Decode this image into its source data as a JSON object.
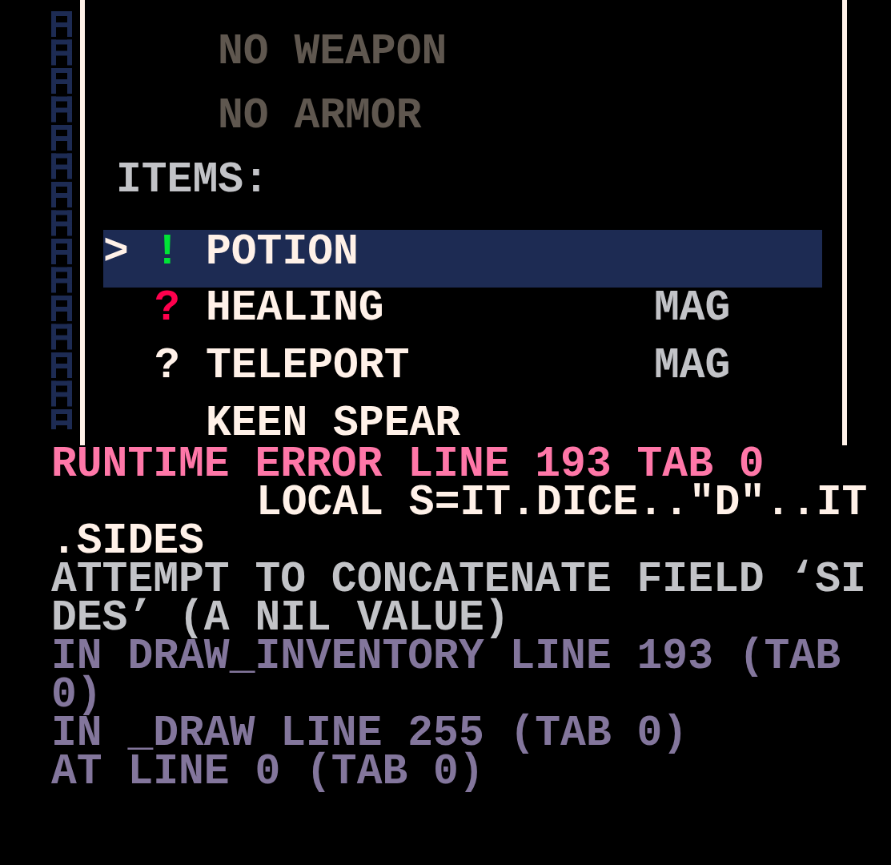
{
  "inventory": {
    "weapon": "NO WEAPON",
    "armor": "NO ARMOR",
    "items_label": "ITEMS:",
    "items": [
      {
        "selected": true,
        "cursor": ">",
        "symbol": "!",
        "color": "#00e436",
        "name": "POTION"
      },
      {
        "selected": false,
        "symbol": "?",
        "color": "#ff004d",
        "name": "HEALING",
        "tag": "MAG"
      },
      {
        "selected": false,
        "symbol": "?",
        "color": "#fff1e8",
        "name": "TELEPORT",
        "tag": "MAG"
      },
      {
        "selected": false,
        "name": "KEEN SPEAR"
      }
    ]
  },
  "error": {
    "lines": [
      {
        "kind": "header",
        "text": "RUNTIME ERROR LINE 193 TAB 0"
      },
      {
        "kind": "source",
        "text": "LOCAL S=IT.DICE..\"D\"..IT"
      },
      {
        "kind": "source_wrap",
        "text": ".SIDES"
      },
      {
        "kind": "message",
        "text": "ATTEMPT TO CONCATENATE FIELD ‘SI"
      },
      {
        "kind": "message",
        "text": "DES’ (A NIL VALUE)"
      },
      {
        "kind": "trace",
        "text": "IN DRAW_INVENTORY LINE 193 (TAB"
      },
      {
        "kind": "trace",
        "text": "0)"
      },
      {
        "kind": "trace",
        "text": "IN _DRAW LINE 255 (TAB 0)"
      },
      {
        "kind": "trace",
        "text": "AT LINE 0 (TAB 0)"
      }
    ]
  }
}
